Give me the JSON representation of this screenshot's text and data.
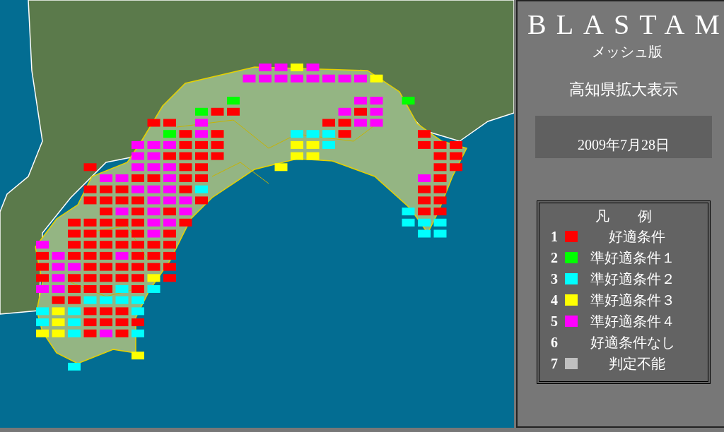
{
  "panel": {
    "title": "BLASTAM",
    "subtitle": "メッシュ版",
    "view": "高知県拡大表示",
    "date": "2009年7月28日"
  },
  "legend": {
    "title": "凡　　例",
    "items": [
      {
        "number": "1",
        "label": "好適条件",
        "color": "#ff0000"
      },
      {
        "number": "2",
        "label": "準好適条件１",
        "color": "#00ff00"
      },
      {
        "number": "3",
        "label": "準好適条件２",
        "color": "#00ffff"
      },
      {
        "number": "4",
        "label": "準好適条件３",
        "color": "#ffff00"
      },
      {
        "number": "5",
        "label": "準好適条件４",
        "color": "#ff00ff"
      },
      {
        "number": "6",
        "label": "好適条件なし"
      },
      {
        "number": "7",
        "label": "判定不能",
        "color": "#c0c0c0"
      }
    ]
  }
}
